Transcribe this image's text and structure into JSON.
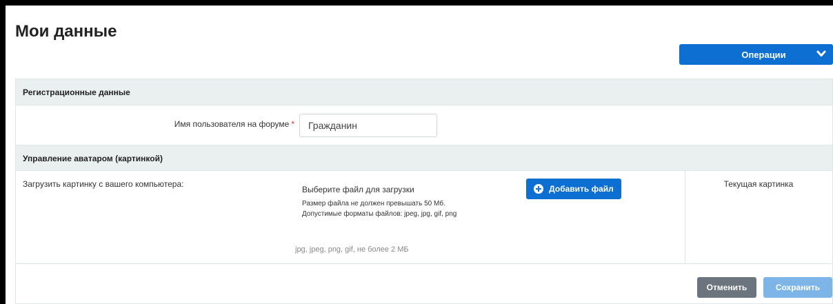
{
  "page": {
    "title": "Мои данные"
  },
  "toolbar": {
    "operations_label": "Операции",
    "operations_icon": "chevron-down-icon"
  },
  "registration": {
    "section_title": "Регистрационные данные",
    "username_label": "Имя пользователя на форуме",
    "required_mark": "*",
    "username_value": "Гражданин"
  },
  "avatar": {
    "section_title": "Управление аватаром (картинкой)",
    "upload_label": "Загрузить картинку с вашего компьютера:",
    "file_title": "Выберите файл для загрузки",
    "file_size_note": "Размер файла не должен превышать 50 Мб.",
    "file_formats_note": "Допустимые форматы файлов: jpeg, jpg, gif, png",
    "add_file_label": "Добавить файл",
    "add_file_icon": "plus-circle-icon",
    "formats_hint": "jpg, jpeg, png, gif, не более 2 МБ",
    "current_label": "Текущая картинка"
  },
  "actions": {
    "cancel_label": "Отменить",
    "save_label": "Сохранить"
  },
  "colors": {
    "primary": "#0c6fd1",
    "primary_disabled": "#7db5e8",
    "secondary": "#6c757d",
    "section_bg": "#e9f0ef",
    "required": "#e0302a"
  }
}
